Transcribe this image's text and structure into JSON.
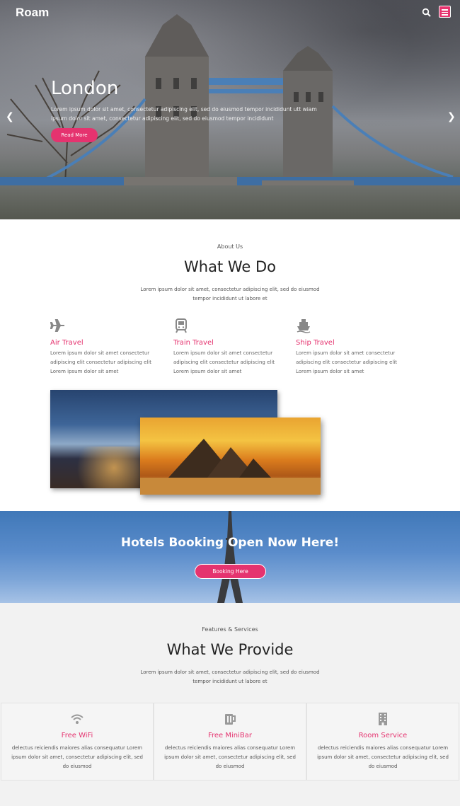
{
  "header": {
    "brand": "Roam",
    "icons": [
      "search-icon",
      "menu-icon"
    ]
  },
  "hero": {
    "title": "London",
    "text": "Lorem ipsum dolor sit amet, consectetur adipiscing elit, sed do eiusmod tempor incididunt utt wiam ipsum dolor sit amet, consectetur adipiscing elit, sed do eiusmod tempor incididunt",
    "button": "Read More",
    "prev_icon": "chevron-left-icon",
    "next_icon": "chevron-right-icon"
  },
  "about": {
    "label": "About Us",
    "title": "What We Do",
    "desc": "Lorem ipsum dolor sit amet, consectetur adipiscing elit, sed do eiusmod tempor incididunt ut labore et",
    "services": [
      {
        "icon": "airplane-icon",
        "title": "Air Travel",
        "text": "Lorem ipsum dolor sit amet consectetur adipiscing elit consectetur adipiscing elit Lorem ipsum dolor sit amet"
      },
      {
        "icon": "train-icon",
        "title": "Train Travel",
        "text": "Lorem ipsum dolor sit amet consectetur adipiscing elit consectetur adipiscing elit Lorem ipsum dolor sit amet"
      },
      {
        "icon": "ship-icon",
        "title": "Ship Travel",
        "text": "Lorem ipsum dolor sit amet consectetur adipiscing elit consectetur adipiscing elit Lorem ipsum dolor sit amet"
      }
    ]
  },
  "banner": {
    "title": "Hotels Booking Open Now Here!",
    "button": "Booking Here"
  },
  "features": {
    "label": "Features & Services",
    "title": "What We Provide",
    "desc": "Lorem ipsum dolor sit amet, consectetur adipiscing elit, sed do eiusmod tempor incididunt ut labore et",
    "items": [
      {
        "icon": "wifi-icon",
        "title": "Free WiFi",
        "text": "delectus reiciendis maiores alias consequatur Lorem ipsum dolor sit amet, consectetur adipiscing elit, sed do eiusmod"
      },
      {
        "icon": "minibar-icon",
        "title": "Free MiniBar",
        "text": "delectus reiciendis maiores alias consequatur Lorem ipsum dolor sit amet, consectetur adipiscing elit, sed do eiusmod"
      },
      {
        "icon": "building-icon",
        "title": "Room Service",
        "text": "delectus reiciendis maiores alias consequatur Lorem ipsum dolor sit amet, consectetur adipiscing elit, sed do eiusmod"
      }
    ]
  },
  "colors": {
    "accent": "#e5336f"
  }
}
